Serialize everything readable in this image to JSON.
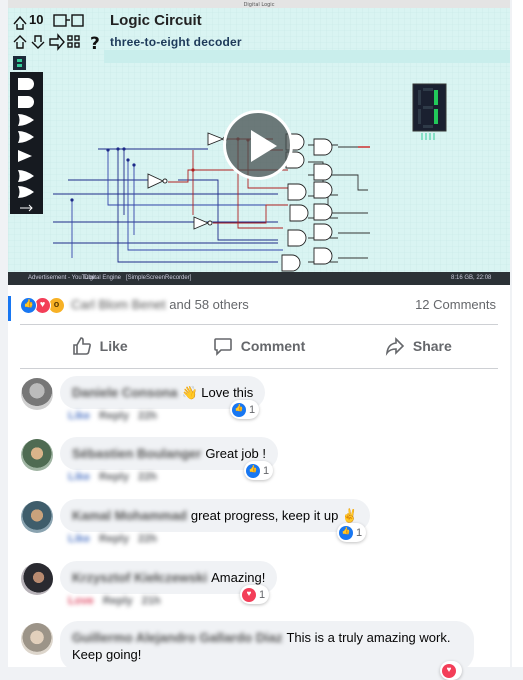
{
  "video": {
    "app_title": "Logic Circuit",
    "app_subtitle": "three-to-eight decoder",
    "zoom_level": "10",
    "window_title": "Digital Logic",
    "taskbar_items": [
      "Advertisement - YouTube",
      "Digital Engine",
      "[SimpleScreenRecorder]"
    ],
    "taskbar_clock": "8:16 GB, 22:08"
  },
  "reactions": {
    "types": [
      "like-icon",
      "love-icon",
      "wow-icon"
    ],
    "first_name": "Carl Blom Benet",
    "others_text": "and 58 others",
    "comments_count": "12 Comments"
  },
  "actions": {
    "like": "Like",
    "comment": "Comment",
    "share": "Share"
  },
  "comments": [
    {
      "name": "Daniele Consona",
      "text": "👋 Love this",
      "reaction_count": "1",
      "reaction": "like",
      "meta": [
        "Like",
        "Reply",
        "22h"
      ]
    },
    {
      "name": "Sébastien Boulanger",
      "text": "Great job !",
      "reaction_count": "1",
      "reaction": "like",
      "meta": [
        "Like",
        "Reply",
        "22h"
      ]
    },
    {
      "name": "Kamal Mohammad",
      "text": "great progress, keep it up ✌",
      "reaction_count": "1",
      "reaction": "like",
      "meta": [
        "Like",
        "Reply",
        "22h"
      ]
    },
    {
      "name": "Krzysztof Kiełczewski",
      "text": "Amazing!",
      "reaction_count": "1",
      "reaction": "love",
      "meta": [
        "Love",
        "Reply",
        "21h"
      ]
    },
    {
      "name": "Guillermo Alejandro Gallardo Diaz",
      "text": "This is a truly amazing work. Keep going!",
      "reaction_count": "",
      "reaction": "love",
      "meta": []
    }
  ],
  "colors": {
    "accent": "#1877f2",
    "love": "#f33e58",
    "wow": "#f7b125",
    "canvas": "#d9f4f2"
  }
}
